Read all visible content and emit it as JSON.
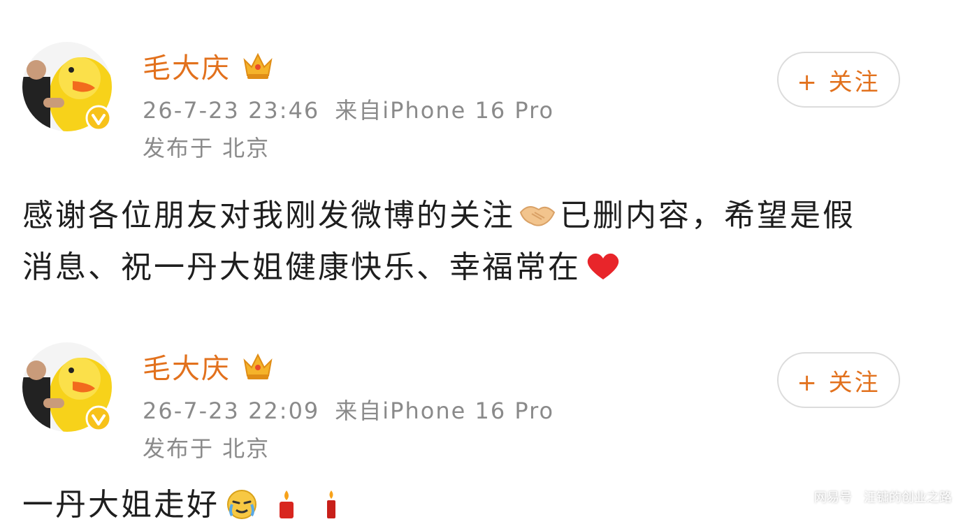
{
  "posts": [
    {
      "username": "毛大庆",
      "time": "26-7-23 23:46",
      "source": "来自iPhone 16 Pro",
      "location": "发布于 北京",
      "follow_label": "+ 关注",
      "content_line1": "感谢各位朋友对我刚发微博的关注",
      "content_line1_tail": "已删内容，希望是假",
      "content_line2": "消息、祝一丹大姐健康快乐、幸福常在",
      "emojis": [
        "handshake-icon",
        "heart-icon"
      ]
    },
    {
      "username": "毛大庆",
      "time": "26-7-23 22:09",
      "source": "来自iPhone 16 Pro",
      "location": "发布于 北京",
      "follow_label": "+ 关注",
      "content_line1": "一丹大姐走好",
      "emojis": [
        "crying-face-icon",
        "candle-icon",
        "candle-icon"
      ]
    }
  ],
  "watermark": {
    "brand": "网易号",
    "account": "汪镛的创业之路"
  },
  "colors": {
    "username": "#e2711d",
    "meta": "#8a8a8a",
    "content": "#1e1e1e",
    "border": "#dcdcdc"
  }
}
